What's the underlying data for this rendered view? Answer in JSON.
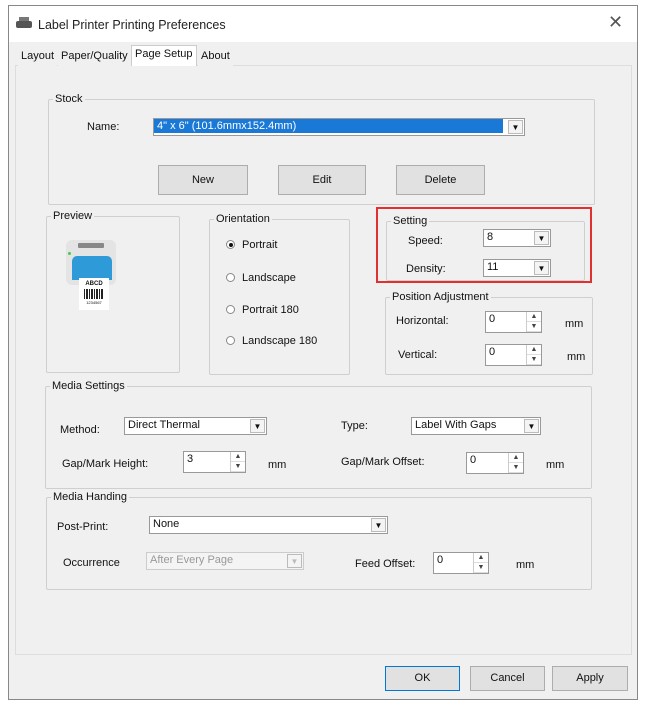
{
  "window": {
    "title": "Label Printer Printing Preferences",
    "close": "✕"
  },
  "tabs": [
    {
      "label": "Layout"
    },
    {
      "label": "Paper/Quality"
    },
    {
      "label": "Page Setup"
    },
    {
      "label": "About"
    }
  ],
  "stock": {
    "legend": "Stock",
    "name_label": "Name:",
    "name_value": "4\" x 6\" (101.6mmx152.4mm)",
    "new": "New",
    "edit": "Edit",
    "delete": "Delete"
  },
  "preview": {
    "legend": "Preview",
    "label_text": "ABCD",
    "barcode_number": "1234567"
  },
  "orientation": {
    "legend": "Orientation",
    "options": [
      "Portrait",
      "Landscape",
      "Portrait 180",
      "Landscape 180"
    ],
    "selected": "Portrait"
  },
  "setting": {
    "legend": "Setting",
    "speed_label": "Speed:",
    "speed": "8",
    "density_label": "Density:",
    "density": "11",
    "highlight_color": "#e03030"
  },
  "position": {
    "legend": "Position Adjustment",
    "horizontal_label": "Horizontal:",
    "horizontal": "0",
    "vertical_label": "Vertical:",
    "vertical": "0",
    "unit": "mm"
  },
  "media_settings": {
    "legend": "Media Settings",
    "method_label": "Method:",
    "method": "Direct Thermal",
    "type_label": "Type:",
    "type": "Label With Gaps",
    "gap_height_label": "Gap/Mark Height:",
    "gap_height": "3",
    "gap_offset_label": "Gap/Mark Offset:",
    "gap_offset": "0",
    "unit": "mm"
  },
  "media_handling": {
    "legend": "Media Handing",
    "post_print_label": "Post-Print:",
    "post_print": "None",
    "occurrence_label": "Occurrence",
    "occurrence": "After Every Page",
    "feed_offset_label": "Feed Offset:",
    "feed_offset": "0",
    "unit": "mm"
  },
  "buttons": {
    "ok": "OK",
    "cancel": "Cancel",
    "apply": "Apply"
  }
}
